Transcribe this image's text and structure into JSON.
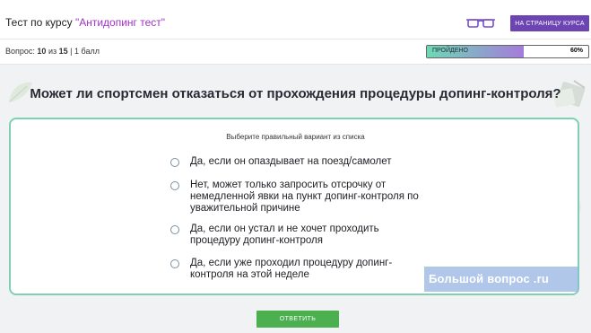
{
  "header": {
    "course_prefix": "Тест по курсу ",
    "course_name": "\"Антидопинг тест\"",
    "course_page_button": "НА СТРАНИЦУ КУРСА",
    "glasses_icon": "glasses-icon"
  },
  "progress": {
    "question_label": "Вопрос:",
    "question_current": "10",
    "question_of": "из",
    "question_total": "15",
    "points": "| 1 балл",
    "label": "ПРОЙДЕНО",
    "percent_text": "60%",
    "percent_value": 60,
    "fill_color_start": "#6ed8b5",
    "fill_color_end": "#a47bdc"
  },
  "question": {
    "text": "Может ли спортсмен отказаться от прохождения процедуры допинг-контроля?",
    "instruction": "Выберите правильный вариант из списка",
    "options": [
      "Да, если он опаздывает на поезд/самолет",
      "Нет, может только запросить отсрочку от немедленной явки на пункт допинг-контроля по уважительной причине",
      "Да, если он устал и не хочет проходить процедуру допинг-контроля",
      "Да, если уже проходил процедуру допинг-контроля на этой неделе"
    ]
  },
  "watermark": {
    "text": "Большой вопрос .ru"
  },
  "actions": {
    "answer_button": "ОТВЕТИТЬ"
  },
  "colors": {
    "accent_purple": "#6c45b3",
    "course_name": "#a12fc8",
    "card_border": "#7fd0b2",
    "answer_green": "#4caf50"
  }
}
